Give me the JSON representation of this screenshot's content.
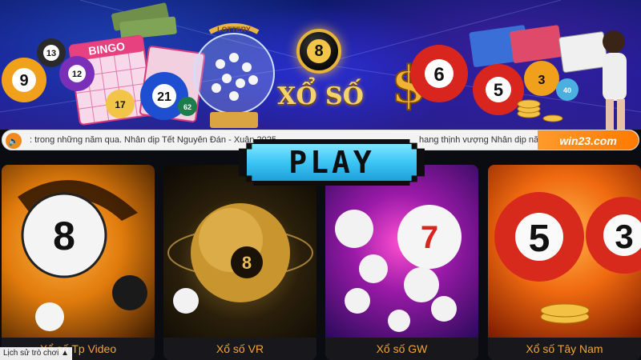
{
  "banner": {
    "title": "XỔ SỐ",
    "badge_number": "8",
    "bingo_label": "BINGO",
    "lottery_label": "LOTTERY",
    "balls_left": [
      "13",
      "9",
      "12",
      "21",
      "17",
      "62"
    ],
    "balls_right": [
      "6",
      "5",
      "3",
      "40"
    ]
  },
  "ticker": {
    "message_left": ": trong những năm qua. Nhân dịp Tết Nguyên Đán - Xuân 2025",
    "message_right": "hang thịnh vượng Nhân dịp năm m",
    "brand": "win23.com"
  },
  "play_button": {
    "label": "PLAY"
  },
  "games": [
    {
      "name": "Xổ số Tp Video",
      "ball": "8"
    },
    {
      "name": "Xổ số VR",
      "ball": "8"
    },
    {
      "name": "Xổ số GW",
      "ball": "7"
    },
    {
      "name": "Xổ số Tây Nam",
      "ball": "5"
    }
  ],
  "history_button": {
    "label": "Lịch sử trò chơi"
  },
  "colors": {
    "accent_orange": "#f0a53a",
    "ticker_orange": "#ff8a1a",
    "play_cyan": "#3cc5f5"
  }
}
